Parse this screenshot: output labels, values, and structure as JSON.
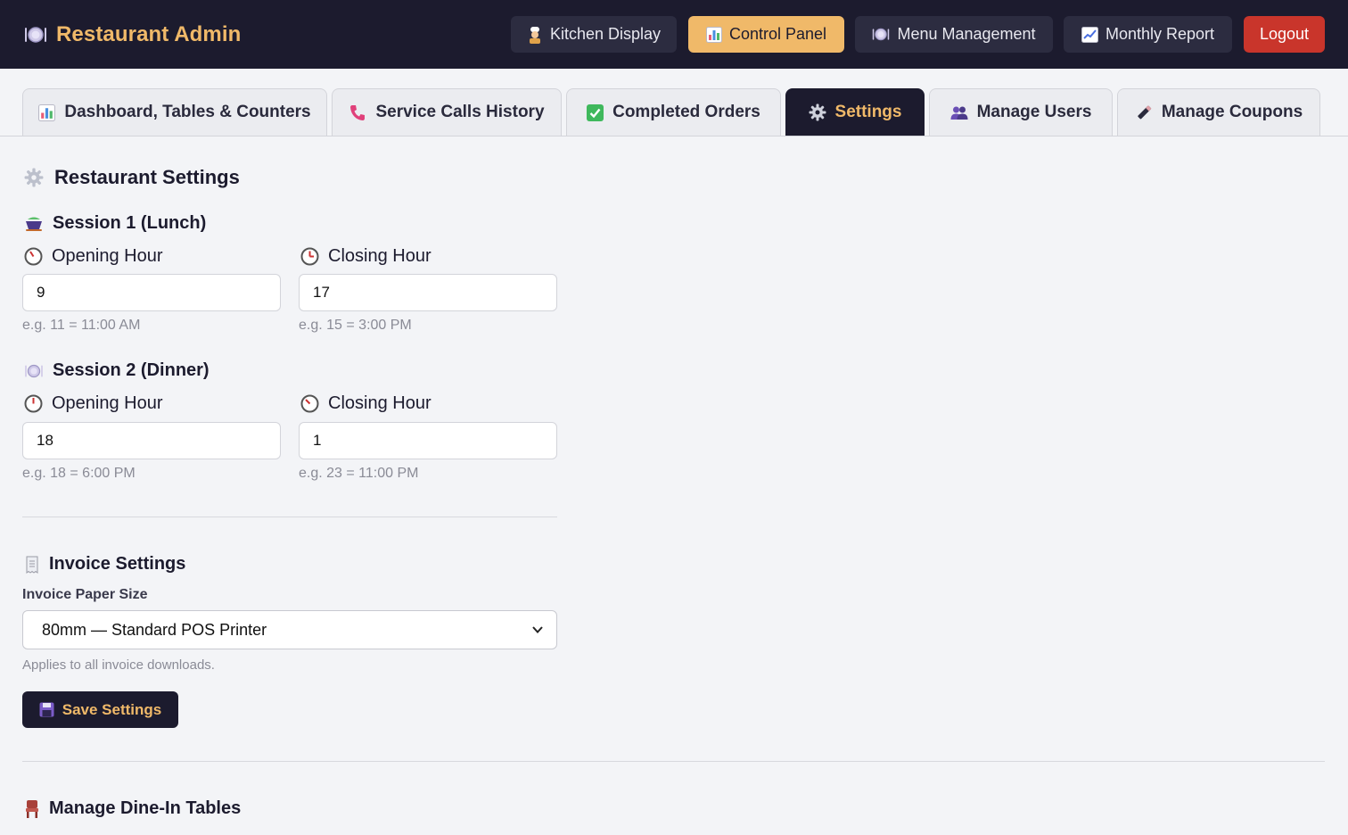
{
  "header": {
    "brand_title": "Restaurant Admin",
    "brand_icon": "plate-icon",
    "nav": [
      {
        "label": "Kitchen Display",
        "icon": "chef-icon"
      },
      {
        "label": "Control Panel",
        "icon": "bar-chart-icon",
        "active": true
      },
      {
        "label": "Menu Management",
        "icon": "plate-icon"
      },
      {
        "label": "Monthly Report",
        "icon": "trend-chart-icon"
      },
      {
        "label": "Logout"
      }
    ]
  },
  "tabs": [
    {
      "label": "Dashboard, Tables & Counters",
      "icon": "bar-chart-icon"
    },
    {
      "label": "Service Calls History",
      "icon": "phone-icon"
    },
    {
      "label": "Completed Orders",
      "icon": "check-box-icon"
    },
    {
      "label": "Settings",
      "icon": "gear-icon",
      "active": true
    },
    {
      "label": "Manage Users",
      "icon": "users-icon"
    },
    {
      "label": "Manage Coupons",
      "icon": "pen-icon"
    }
  ],
  "settings": {
    "title": "Restaurant Settings",
    "session1": {
      "title": "Session 1 (Lunch)",
      "opening_label": "Opening Hour",
      "opening_value": "9",
      "opening_hint": "e.g. 11 = 11:00 AM",
      "closing_label": "Closing Hour",
      "closing_value": "17",
      "closing_hint": "e.g. 15 = 3:00 PM"
    },
    "session2": {
      "title": "Session 2 (Dinner)",
      "opening_label": "Opening Hour",
      "opening_value": "18",
      "opening_hint": "e.g. 18 = 6:00 PM",
      "closing_label": "Closing Hour",
      "closing_value": "1",
      "closing_hint": "e.g. 23 = 11:00 PM"
    },
    "invoice": {
      "title": "Invoice Settings",
      "paper_label": "Invoice Paper Size",
      "paper_value": "80mm — Standard POS Printer",
      "paper_hint": "Applies to all invoice downloads."
    },
    "save_label": "Save Settings",
    "tables_title": "Manage Dine-In Tables"
  },
  "colors": {
    "header_bg": "#1c1b2e",
    "accent": "#f0b969",
    "logout": "#c9352b",
    "page_bg": "#f3f4f7"
  }
}
